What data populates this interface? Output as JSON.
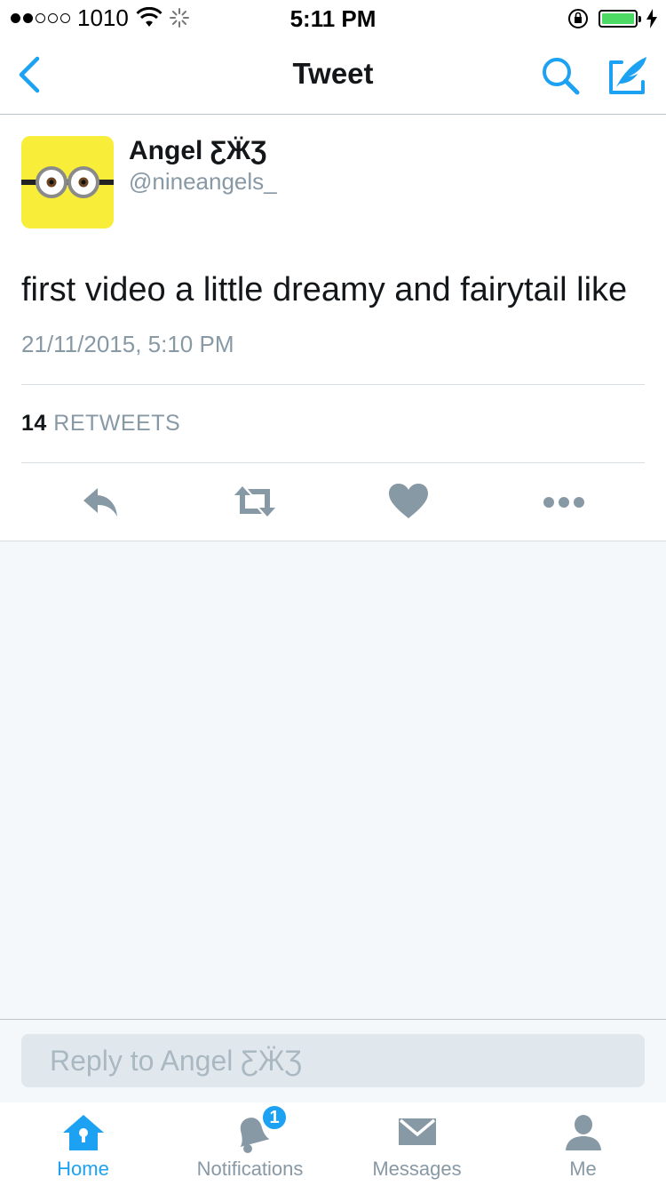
{
  "status_bar": {
    "carrier": "1010",
    "time": "5:11 PM"
  },
  "nav": {
    "title": "Tweet"
  },
  "tweet": {
    "author_name": "Angel ƸӜƷ",
    "author_handle": "@nineangels_",
    "text": "first video a little dreamy and fairytail like",
    "timestamp": "21/11/2015, 5:10 PM",
    "retweet_count": "14",
    "retweet_label": "RETWEETS"
  },
  "reply": {
    "placeholder": "Reply to Angel ƸӜƷ",
    "value": ""
  },
  "tabs": [
    {
      "label": "Home",
      "active": true
    },
    {
      "label": "Notifications",
      "badge": "1"
    },
    {
      "label": "Messages"
    },
    {
      "label": "Me"
    }
  ],
  "colors": {
    "accent": "#1da1f2",
    "muted": "#8899a6",
    "avatar_bg": "#f8ee3a"
  },
  "icons": [
    "back-icon",
    "search-icon",
    "compose-icon",
    "reply-icon",
    "retweet-icon",
    "like-icon",
    "more-icon",
    "home-icon",
    "notifications-icon",
    "messages-icon",
    "me-icon"
  ]
}
